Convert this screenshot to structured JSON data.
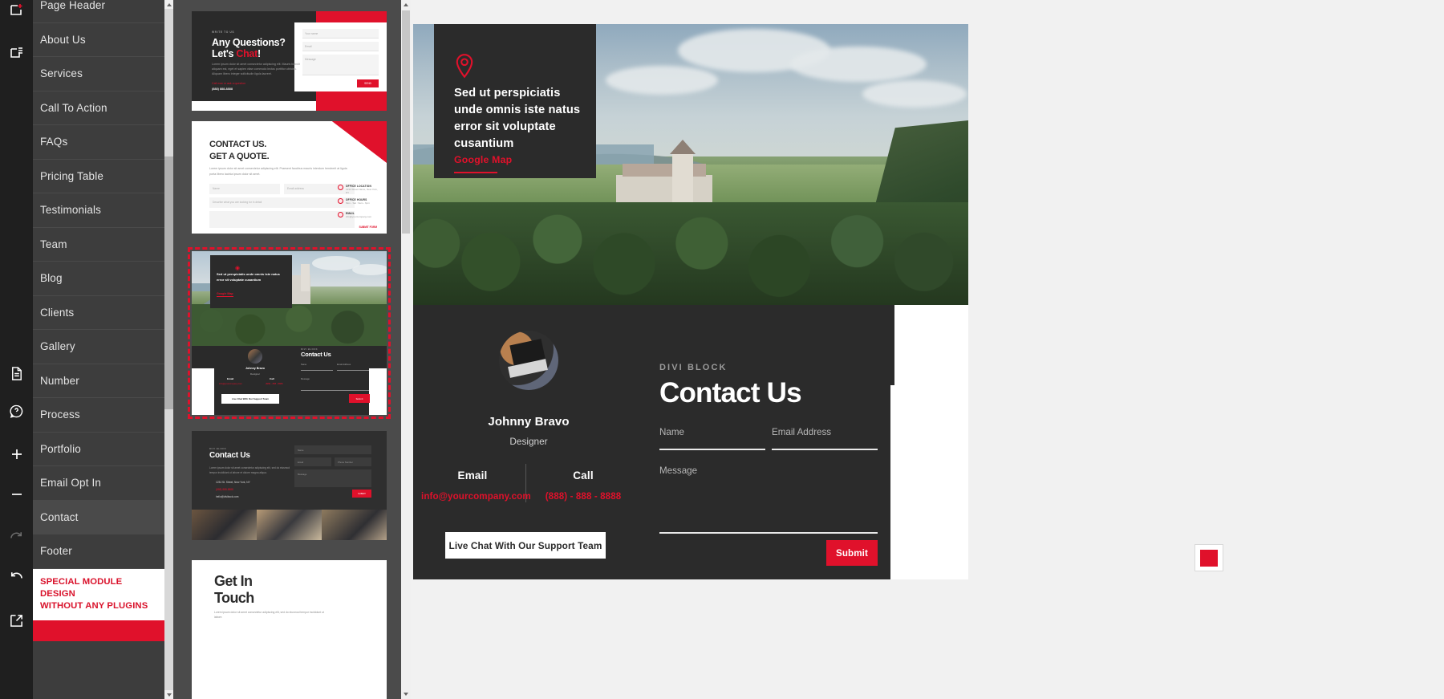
{
  "icon_rail": {
    "icons": [
      {
        "name": "new-page-icon",
        "glyph": "page-plus"
      },
      {
        "name": "page-list-icon",
        "glyph": "page-list"
      },
      {
        "name": "document-icon",
        "glyph": "document"
      },
      {
        "name": "help-icon",
        "glyph": "help-bubble"
      },
      {
        "name": "zoom-in-icon",
        "glyph": "plus"
      },
      {
        "name": "zoom-out-icon",
        "glyph": "minus"
      },
      {
        "name": "redo-icon",
        "glyph": "redo"
      },
      {
        "name": "undo-icon",
        "glyph": "undo"
      },
      {
        "name": "external-link-icon",
        "glyph": "external-link"
      }
    ]
  },
  "module_panel": {
    "items": [
      {
        "label": "Page Header",
        "active": false
      },
      {
        "label": "About Us",
        "active": false
      },
      {
        "label": "Services",
        "active": false
      },
      {
        "label": "Call To Action",
        "active": false
      },
      {
        "label": "FAQs",
        "active": false
      },
      {
        "label": "Pricing Table",
        "active": false
      },
      {
        "label": "Testimonials",
        "active": false
      },
      {
        "label": "Team",
        "active": false
      },
      {
        "label": "Blog",
        "active": false
      },
      {
        "label": "Clients",
        "active": false
      },
      {
        "label": "Gallery",
        "active": false
      },
      {
        "label": "Number",
        "active": false
      },
      {
        "label": "Process",
        "active": false
      },
      {
        "label": "Portfolio",
        "active": false
      },
      {
        "label": "Email Opt In",
        "active": false
      },
      {
        "label": "Contact",
        "active": true
      },
      {
        "label": "Footer",
        "active": false
      }
    ],
    "promo_line1": "SPECIAL MODULE DESIGN",
    "promo_line2": "WITHOUT ANY PLUGINS"
  },
  "thumbnails": {
    "thumb1": {
      "eyebrow": "WRITE TO US",
      "heading_a": "Any Questions?",
      "heading_b": "Let's ",
      "heading_accent": "Chat",
      "heading_b_end": "!",
      "body": "Lorem ipsum dolor sit amet consectetur adipiscing elit. Mauris blandit aliquam est, eget et sapien vitae commodo lectus porttitor ultricies. Aliquam libero integer sollicitudin ligula laoreet.",
      "link": "Call now or ask a question",
      "phone": "(888) 888-8888",
      "field1": "Your name",
      "field2": "Email",
      "field3": "Message",
      "button": "SEND"
    },
    "thumb2": {
      "heading_line1": "CONTACT US.",
      "heading_line2": "GET A QUOTE.",
      "body": "Lorem ipsum dolor sit amet consectetur adipiscing elit. Praesent faucibus mauris interdum hendrerit at ligula porta libero lacinia ipsum dolor sit amet.",
      "field_name": "Name",
      "field_email": "Email address",
      "field_subject": "Describe what you are looking for in detail",
      "info": [
        {
          "title": "OFFICE LOCATION",
          "sub": "1234 Street Name, New York, NY"
        },
        {
          "title": "OFFICE HOURS",
          "sub": "Mon - Sat : 9am - 6pm"
        },
        {
          "title": "EMAIL",
          "sub": "info@yourcompany.com"
        }
      ],
      "submit": "SUBMIT FORM"
    },
    "thumb3": {
      "selected": true,
      "card_text": "Sed ut perspiciatis unde omnis iste natus error sit voluptate cusantium",
      "card_link": "Google Map",
      "person_name": "Johnny Bravo",
      "person_role": "Designer",
      "eyebrow": "DIVI BLOCK",
      "title": "Contact Us",
      "email_label": "Email",
      "email_value": "info@yourcompany.com",
      "call_label": "Call",
      "call_value": "(888) - 888 - 8888",
      "chat_button": "Live Chat With Our Support Team",
      "field_name": "Name",
      "field_email": "Email Address",
      "field_message": "Message",
      "submit": "Submit"
    },
    "thumb4": {
      "eyebrow": "DIVI BLOCK",
      "title": "Contact Us",
      "body": "Lorem ipsum dolor sit amet consectetur adipiscing elit, sed do eiusmod tempor incididunt ut labore et dolore magna aliqua.",
      "row1": "1234 St. Street, New York, NY",
      "row2": "(888) 888-8888",
      "row3": "hello@divibock.com",
      "field_name": "Name",
      "field_email": "Email",
      "field_phone": "Phone Number",
      "field_message": "Message",
      "submit": "SUBMIT"
    },
    "thumb5": {
      "heading_line1": "Get In",
      "heading_line2": "Touch",
      "body": "Lorem ipsum dolor sit amet consectetur adipiscing elit, sed do eiusmod tempor incididunt ut labore."
    }
  },
  "preview": {
    "hero": {
      "pin_icon": "map-pin-icon",
      "text": "Sed ut perspiciatis unde omnis iste natus error sit voluptate cusantium",
      "link": "Google Map"
    },
    "contact": {
      "avatar": "person-avatar",
      "name": "Johnny Bravo",
      "role": "Designer",
      "email_label": "Email",
      "email_value": "info@yourcompany.com",
      "call_label": "Call",
      "call_value": "(888) - 888 - 8888",
      "chat_button": "Live Chat With Our Support Team"
    },
    "form": {
      "eyebrow": "DIVI BLOCK",
      "title": "Contact Us",
      "name_placeholder": "Name",
      "email_placeholder": "Email Address",
      "message_placeholder": "Message",
      "submit": "Submit"
    }
  },
  "widget": {
    "name": "color-swatch-widget"
  },
  "colors": {
    "accent_red": "#e0112b",
    "panel_dark": "#3d3d3d",
    "rail_dark": "#1f1f1f",
    "section_dark": "#2b2b2b",
    "canvas_gray": "#4b4b4b"
  }
}
